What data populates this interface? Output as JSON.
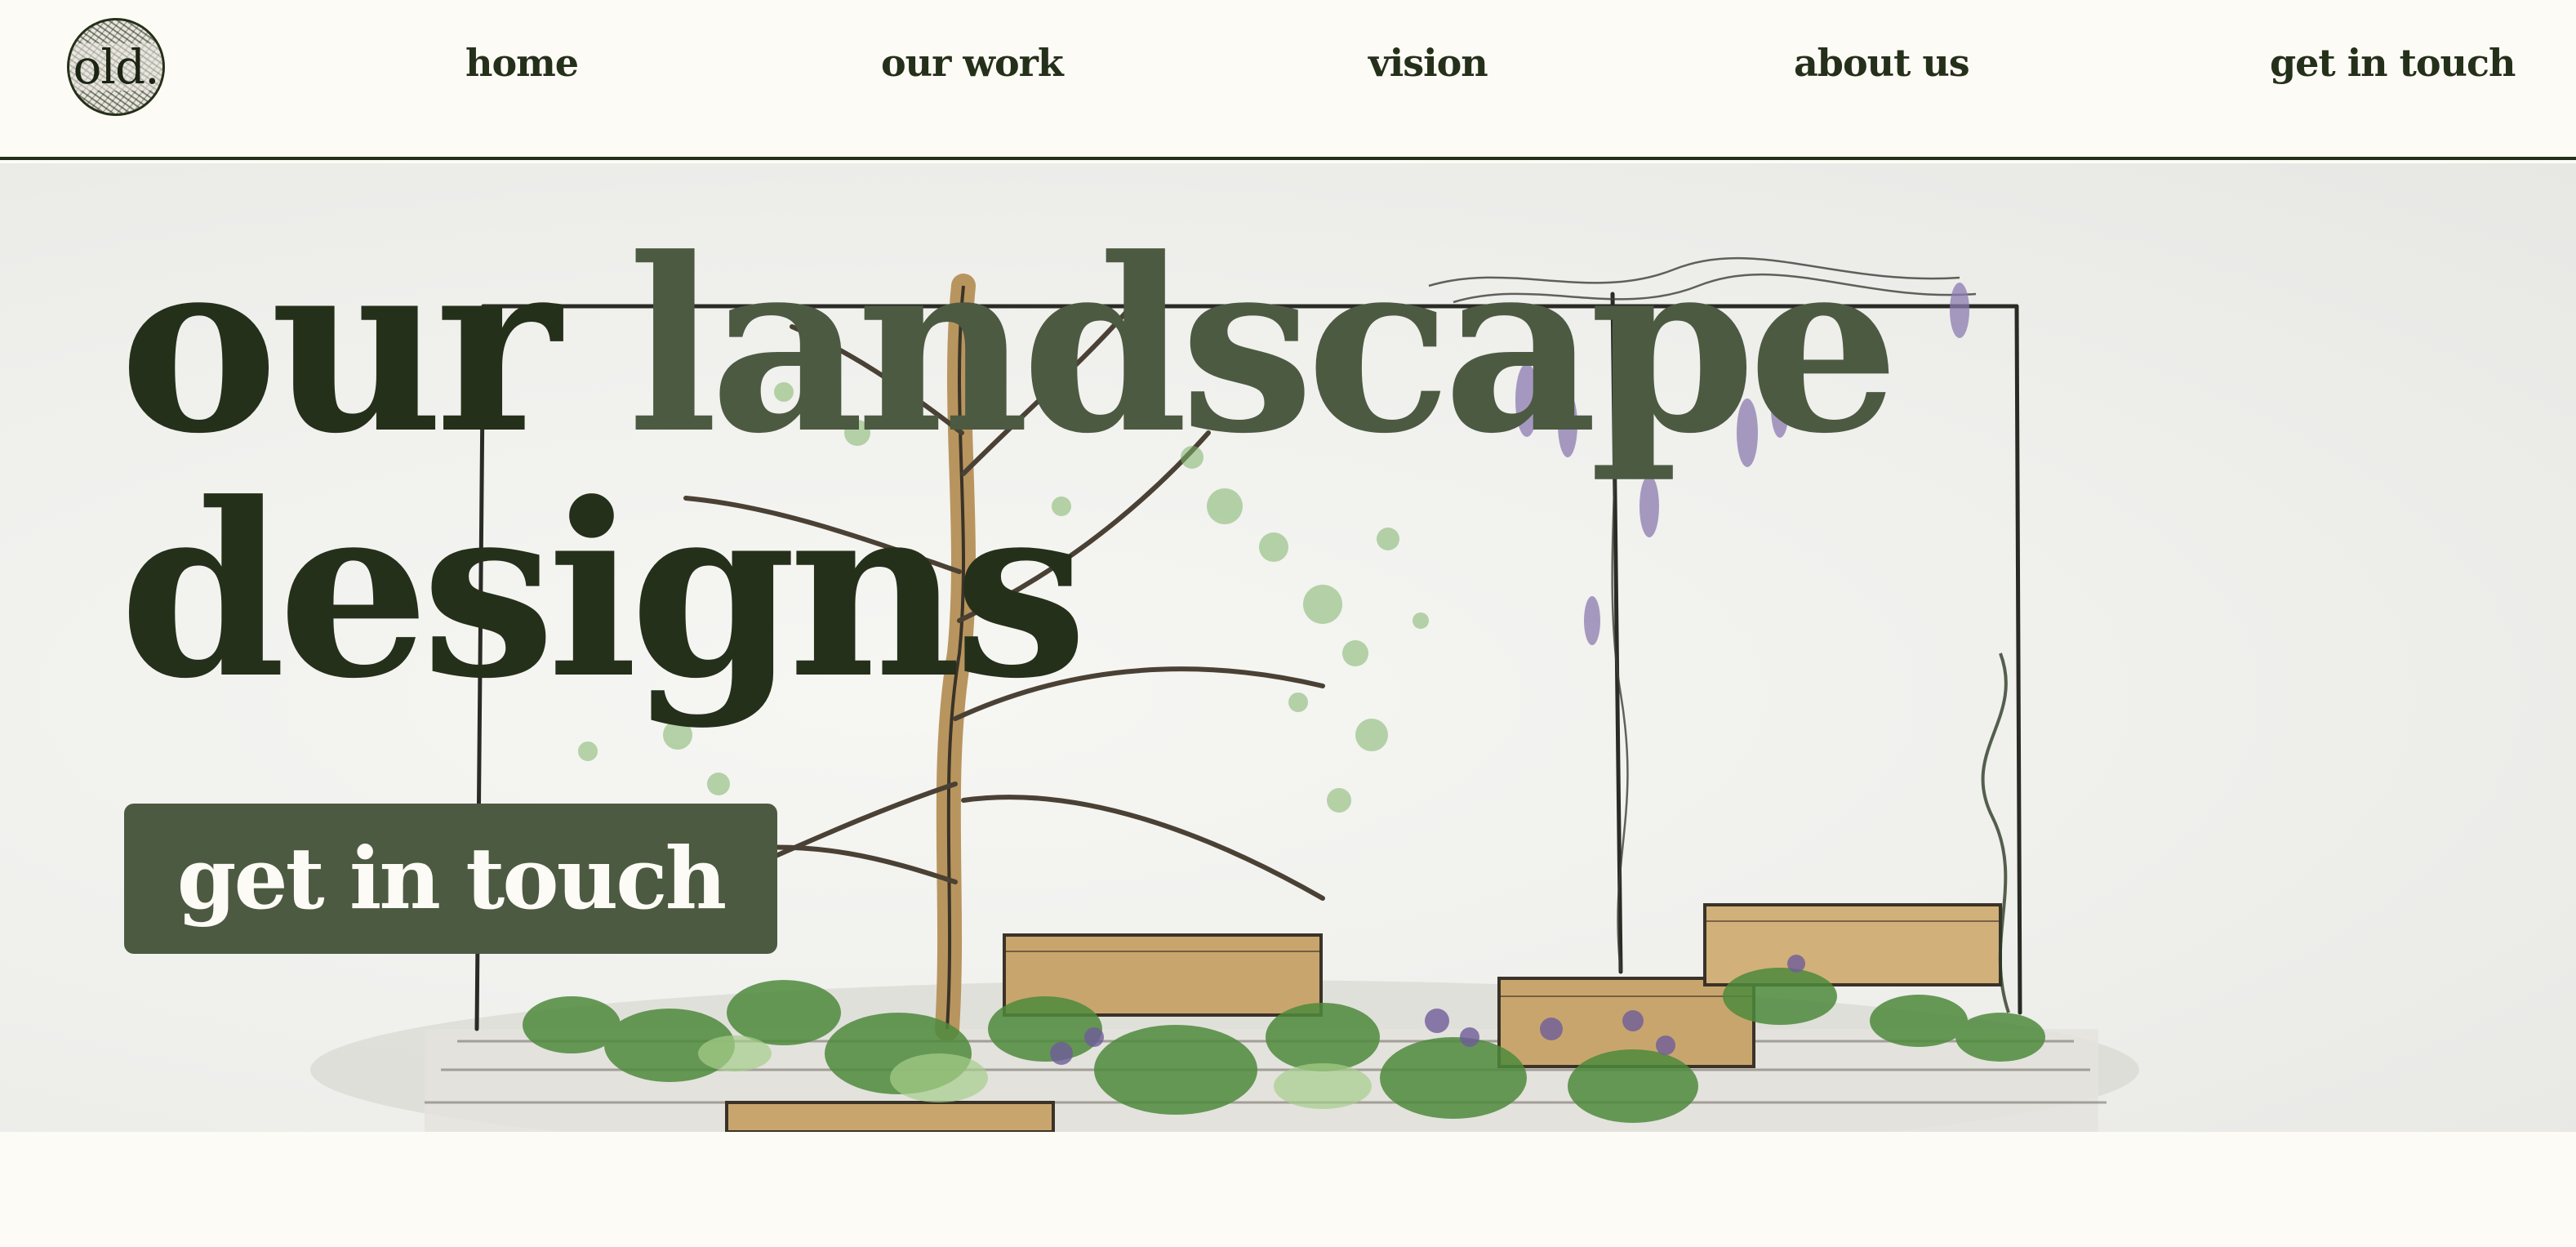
{
  "brand": {
    "logo_text": "old."
  },
  "nav": {
    "items": [
      {
        "label": "home"
      },
      {
        "label": "our work"
      },
      {
        "label": "vision"
      },
      {
        "label": "about us"
      },
      {
        "label": "get in touch"
      }
    ]
  },
  "hero": {
    "title_word_1": "our",
    "title_word_2": "landscape",
    "title_line_2": "designs",
    "cta_label": "get in touch",
    "illustration": "hand-drawn garden sketch with tree, wisteria pergola, raised planters and plants"
  },
  "colors": {
    "background": "#fdfbf5",
    "text_dark": "#25301a",
    "accent_green": "#4c5a42",
    "cta_text": "#fdfbf5"
  }
}
